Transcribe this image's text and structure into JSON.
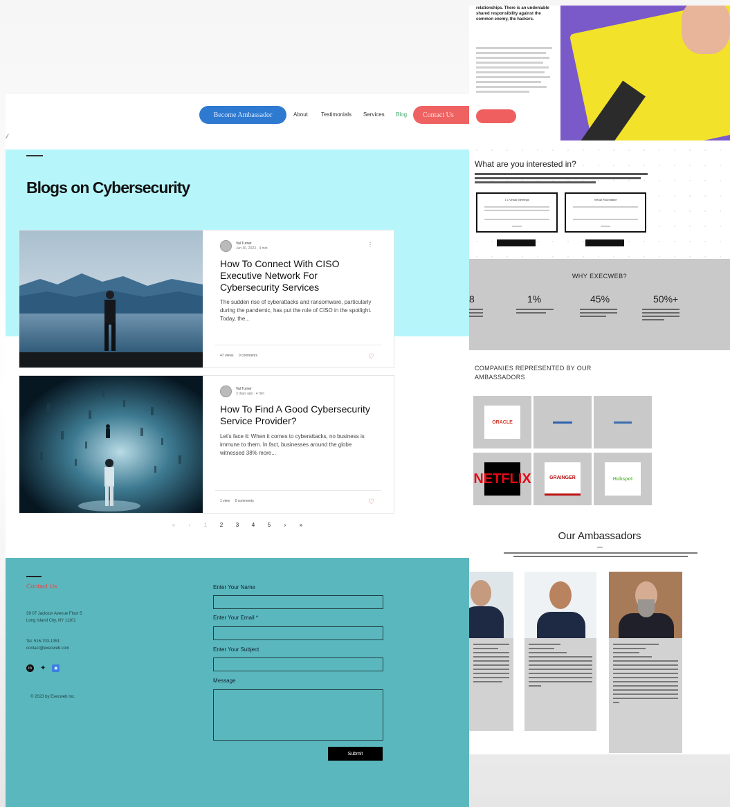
{
  "nav": {
    "become_ambassador": "Become Ambassador",
    "links": [
      "About",
      "Testimonials",
      "Services",
      "Blog"
    ],
    "contact_us": "Contact Us"
  },
  "hero": {
    "title": "Blogs on Cybersecurity"
  },
  "posts": [
    {
      "author": "Val Turner",
      "meta": "Jun 30, 2023  ·  4 min",
      "title": "How To Connect With CISO Executive Network For Cybersecurity Services",
      "excerpt": "The sudden rise of cyberattacks and ransomware, particularly during the pandemic, has put the role of CISO in the spotlight. Today, the...",
      "views": "47 views",
      "comments": "0 comments"
    },
    {
      "author": "Val Turner",
      "meta": "3 days ago  ·  4 min",
      "title": "How To Find A Good Cybersecurity Service Provider?",
      "excerpt": "Let's face it: When it comes to cyberattacks, no business is immune to them. In fact, businesses around the globe witnessed 38% more...",
      "views": "1 view",
      "comments": "0 comments"
    }
  ],
  "pagination": {
    "first": "«",
    "prev": "‹",
    "pages": [
      "1",
      "2",
      "3",
      "4",
      "5"
    ],
    "current": "1",
    "next": "›",
    "last": "»"
  },
  "footer": {
    "contact_title": "Contact Us",
    "address_line1": "39 07 Jackson Avenue Floor 5",
    "address_line2": "Long Island City, NY 11101",
    "tel": "Tel: 516-703-1351",
    "email": "contact@execweb.com",
    "copyright": "© 2023 by Execweb Inc.",
    "form": {
      "name_label": "Enter Your Name",
      "email_label": "Enter Your Email *",
      "subject_label": "Enter Your Subject",
      "message_label": "Message",
      "submit": "Submit"
    }
  },
  "right_page": {
    "intro_text": "relationships. There is an undeniable shared responsibility against the common enemy, the hackers.",
    "interest_title": "What are you interested in?",
    "card_left": "1:1 Virtual Meetings",
    "card_right": "Virtual Roundtable",
    "why_title": "WHY EXECWEB?",
    "stats": [
      "8",
      "1%",
      "45%",
      "50%+"
    ],
    "companies_title": "COMPANIES REPRESENTED BY OUR AMBASSADORS",
    "logos": [
      "ORACLE",
      "",
      "",
      "NETFLIX",
      "GRAINGER",
      "Hubspot"
    ],
    "ambassadors_title": "Our Ambassadors"
  }
}
